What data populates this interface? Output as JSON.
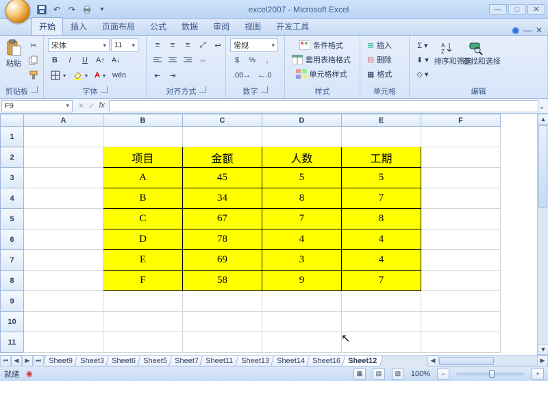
{
  "window": {
    "title": "excel2007 - Microsoft Excel"
  },
  "tabs": {
    "home": "开始",
    "insert": "插入",
    "layout": "页面布局",
    "formulas": "公式",
    "data": "数据",
    "review": "审阅",
    "view": "视图",
    "developer": "开发工具"
  },
  "ribbon": {
    "clipboard": {
      "paste": "粘贴",
      "label": "剪贴板"
    },
    "font": {
      "name": "宋体",
      "size": "11",
      "label": "字体"
    },
    "align": {
      "label": "对齐方式"
    },
    "number": {
      "format": "常规",
      "label": "数字"
    },
    "styles": {
      "cond": "条件格式",
      "table": "套用表格格式",
      "cell": "单元格样式",
      "label": "样式"
    },
    "cells": {
      "insert": "插入",
      "delete": "删除",
      "format": "格式",
      "label": "单元格"
    },
    "editing": {
      "sort": "排序和筛选",
      "find": "查找和选择",
      "label": "编辑"
    }
  },
  "formula_bar": {
    "name": "F9",
    "fx": "fx"
  },
  "columns": [
    "A",
    "B",
    "C",
    "D",
    "E",
    "F"
  ],
  "rows": [
    "1",
    "2",
    "3",
    "4",
    "5",
    "6",
    "7",
    "8",
    "9",
    "10",
    "11"
  ],
  "table": {
    "headers": [
      "项目",
      "金额",
      "人数",
      "工期"
    ],
    "rows": [
      [
        "A",
        "45",
        "5",
        "5"
      ],
      [
        "B",
        "34",
        "8",
        "7"
      ],
      [
        "C",
        "67",
        "7",
        "8"
      ],
      [
        "D",
        "78",
        "4",
        "4"
      ],
      [
        "E",
        "69",
        "3",
        "4"
      ],
      [
        "F",
        "58",
        "9",
        "7"
      ]
    ]
  },
  "chart_data": {
    "type": "table",
    "headers": [
      "项目",
      "金额",
      "人数",
      "工期"
    ],
    "rows": [
      {
        "项目": "A",
        "金额": 45,
        "人数": 5,
        "工期": 5
      },
      {
        "项目": "B",
        "金额": 34,
        "人数": 8,
        "工期": 7
      },
      {
        "项目": "C",
        "金额": 67,
        "人数": 7,
        "工期": 8
      },
      {
        "项目": "D",
        "金额": 78,
        "人数": 4,
        "工期": 4
      },
      {
        "项目": "E",
        "金额": 69,
        "人数": 3,
        "工期": 4
      },
      {
        "项目": "F",
        "金额": 58,
        "人数": 9,
        "工期": 7
      }
    ]
  },
  "sheets": [
    "Sheet9",
    "Sheet3",
    "Sheet6",
    "Sheet5",
    "Sheet7",
    "Sheet11",
    "Sheet13",
    "Sheet14",
    "Sheet16",
    "Sheet12"
  ],
  "active_sheet": "Sheet12",
  "status": {
    "ready": "就绪",
    "zoom": "100%"
  }
}
